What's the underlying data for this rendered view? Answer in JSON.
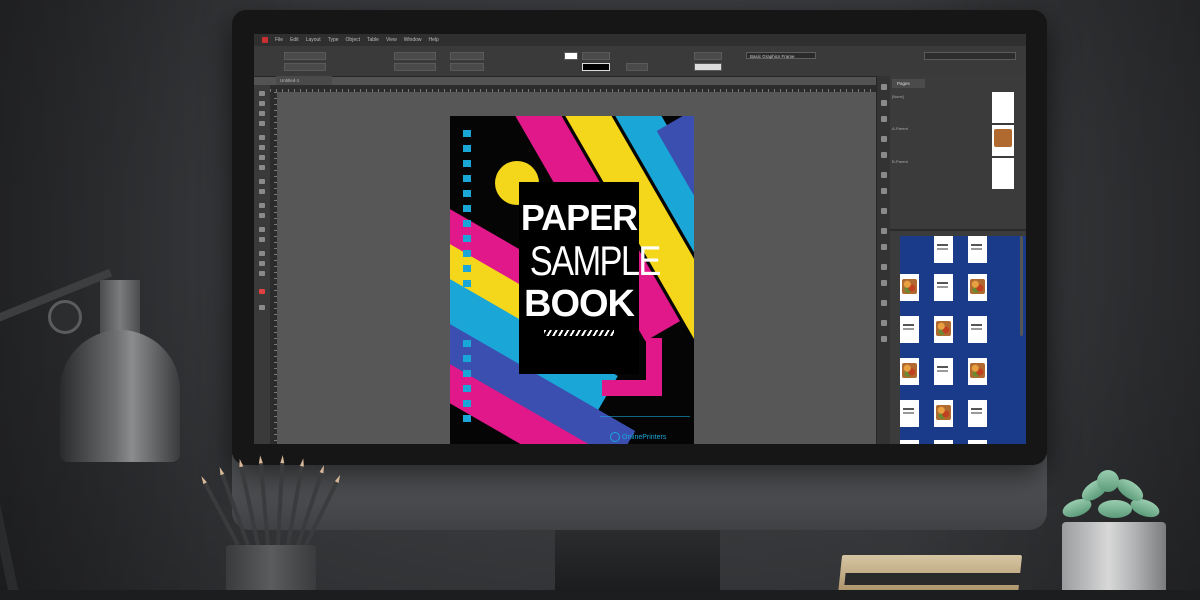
{
  "app": {
    "menu": [
      "File",
      "Edit",
      "Layout",
      "Type",
      "Object",
      "Table",
      "View",
      "Window",
      "Help"
    ],
    "font_field": "Basic Graphics Frame",
    "document_tab": "Untitled-1"
  },
  "pages_panel": {
    "tab_label": "Pages",
    "masters": [
      "[None]",
      "A-Parent",
      "B-Parent"
    ]
  },
  "cover": {
    "line1": "PAPER",
    "line2": "SAMPLE",
    "line3": "BOOK",
    "logo_text": "OnlinePrinters",
    "colors": {
      "magenta": "#e0188a",
      "yellow": "#f4d71a",
      "cyan": "#1ba6d8",
      "blue": "#3b4fb0"
    }
  }
}
